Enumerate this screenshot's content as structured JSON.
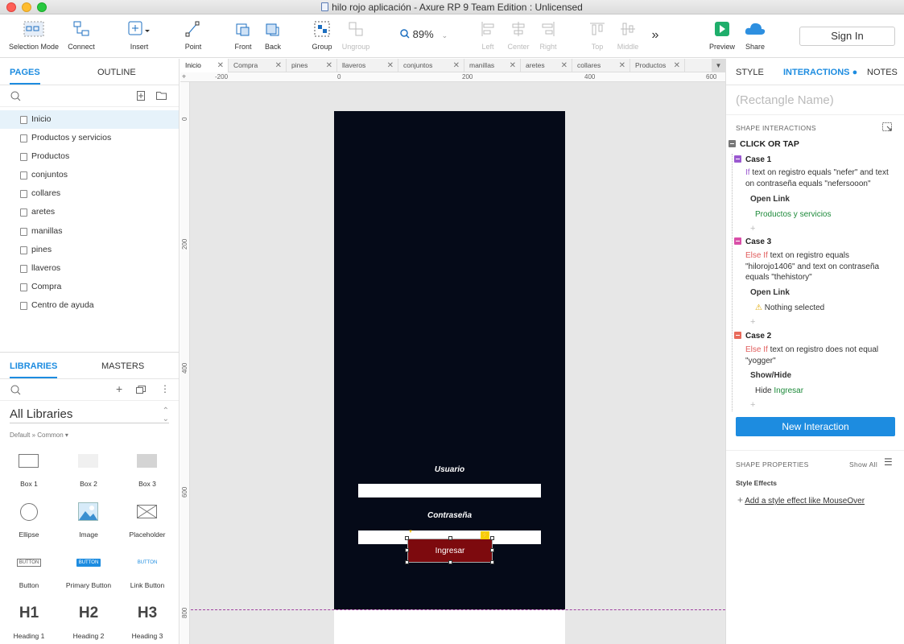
{
  "window": {
    "title": "hilo rojo aplicación - Axure RP 9 Team Edition : Unlicensed"
  },
  "toolbar": {
    "selection_mode": "Selection Mode",
    "connect": "Connect",
    "insert": "Insert",
    "point": "Point",
    "front": "Front",
    "back": "Back",
    "group": "Group",
    "ungroup": "Ungroup",
    "zoom": "89%",
    "left": "Left",
    "center": "Center",
    "right": "Right",
    "top": "Top",
    "middle": "Middle",
    "preview": "Preview",
    "share": "Share",
    "sign_in": "Sign In"
  },
  "left_panel": {
    "tabs": {
      "pages": "PAGES",
      "outline": "OUTLINE"
    },
    "pages": [
      "Inicio",
      "Productos y servicios",
      "Productos",
      "conjuntos",
      "collares",
      "aretes",
      "manillas",
      "pines",
      "llaveros",
      "Compra",
      "Centro de ayuda"
    ],
    "library_tabs": {
      "libraries": "LIBRARIES",
      "masters": "MASTERS"
    },
    "library_select": "All Libraries",
    "library_sub": "Default » Common ▾",
    "widgets": [
      "Box 1",
      "Box 2",
      "Box 3",
      "Ellipse",
      "Image",
      "Placeholder",
      "Button",
      "Primary Button",
      "Link Button",
      "Heading 1",
      "Heading 2",
      "Heading 3"
    ],
    "widget_glyphs": {
      "button": "BUTTON",
      "h1": "H1",
      "h2": "H2",
      "h3": "H3"
    }
  },
  "doc_tabs": [
    "Inicio",
    "Compra",
    "pines",
    "llaveros",
    "conjuntos",
    "manillas",
    "aretes",
    "collares",
    "Productos"
  ],
  "rulers": {
    "horizontal": [
      "-200",
      "0",
      "200",
      "400",
      "600"
    ],
    "vertical": [
      "0",
      "200",
      "400",
      "600",
      "800"
    ]
  },
  "canvas": {
    "user_label": "Usuario",
    "password_label": "Contraseña",
    "login_button": "Ingresar"
  },
  "right_panel": {
    "tabs": {
      "style": "STYLE",
      "interactions": "INTERACTIONS",
      "notes": "NOTES"
    },
    "rect_name_placeholder": "(Rectangle Name)",
    "shape_interactions": "SHAPE INTERACTIONS",
    "event": "CLICK OR TAP",
    "cases": [
      {
        "title": "Case 1",
        "keyword": "If",
        "condition": " text on registro equals \"nefer\" and text on contraseña equals \"nefersooon\"",
        "action": "Open Link",
        "target": "Productos y servicios",
        "color": "#9b59d0"
      },
      {
        "title": "Case 3",
        "keyword": "Else If",
        "condition": " text on registro equals \"hilorojo1406\" and text on contraseña equals \"thehistory\"",
        "action": "Open Link",
        "target": "Nothing selected",
        "color": "#d94fa8"
      },
      {
        "title": "Case 2",
        "keyword": "Else If",
        "condition": " text on registro does not equal \"yogger\"",
        "action": "Show/Hide",
        "target_prefix": "Hide ",
        "target": "Ingresar",
        "color": "#e86a5a"
      }
    ],
    "new_interaction": "New Interaction",
    "shape_properties": "SHAPE PROPERTIES",
    "show_all": "Show All",
    "style_effects": "Style Effects",
    "add_style_effect": "Add a style effect like MouseOver"
  }
}
